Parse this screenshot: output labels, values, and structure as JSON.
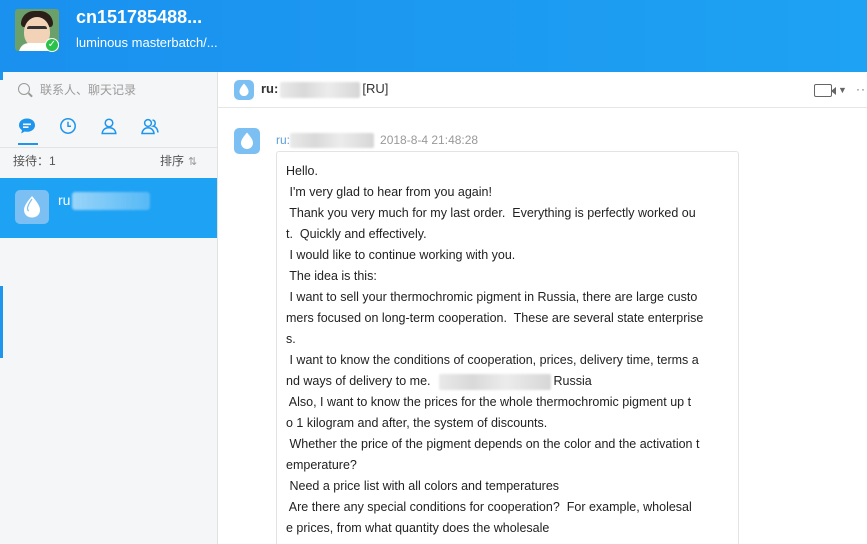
{
  "profile": {
    "name": "cn151785488...",
    "subtitle": "luminous masterbatch/...",
    "verified_mark": "✓"
  },
  "search": {
    "placeholder": "联系人、聊天记录"
  },
  "tabs": [
    {
      "name": "tab-chats",
      "icon": "chat-bubble-icon",
      "active": true
    },
    {
      "name": "tab-recent",
      "icon": "clock-icon"
    },
    {
      "name": "tab-contact",
      "icon": "person-icon"
    },
    {
      "name": "tab-group",
      "icon": "group-icon"
    }
  ],
  "list_header": {
    "waiting": "接待：1",
    "sort": "排序",
    "sort_icon": "⇅"
  },
  "contacts": [
    {
      "name": "ru"
    }
  ],
  "chat": {
    "title_prefix": "ru:",
    "title_suffix": "[RU]"
  },
  "message": {
    "sender": "ru:",
    "timestamp": "2018-8-4 21:48:28",
    "lines": [
      "Hello.",
      " I'm very glad to hear from you again!",
      " Thank you very much for my last order.  Everything is perfectly worked ou",
      "t.  Quickly and effectively.",
      " I would like to continue working with you.",
      " The idea is this:",
      " I want to sell your thermochromic pigment in Russia, there are large custo",
      "mers focused on long-term cooperation.  These are several state enterprise",
      "s.",
      " I want to know the conditions of cooperation, prices, delivery time, terms a",
      "nd ways of delivery to me.",
      " Also, I want to know the prices for the whole thermochromic pigment up t",
      "o 1 kilogram and after, the system of discounts.",
      " Whether the price of the pigment depends on the color and the activation t",
      "emperature?",
      " Need a price list with all colors and temperatures",
      " Are there any special conditions for cooperation?  For example, wholesal",
      "e prices, from what quantity does the wholesale"
    ],
    "delivery_line_tail": "Russia"
  },
  "colors": {
    "header_blue": "#1a90ef",
    "selected_contact": "#1ea2f3",
    "accent": "#1e96ee"
  }
}
